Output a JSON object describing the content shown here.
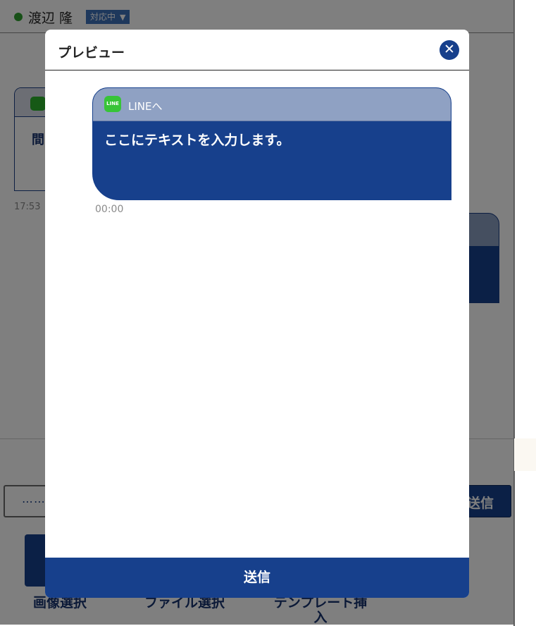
{
  "background": {
    "user": {
      "name": "渡辺 隆",
      "status_label": "対応中",
      "status_caret": "▼",
      "status_dot_color": "#2fa12f"
    },
    "card": {
      "text": "間っ",
      "channel_icon": "line-icon"
    },
    "message_time": "17:53",
    "keyboard_icon": "keyboard-icon",
    "send_label": "送信",
    "tools": {
      "image_label": "画像選択",
      "file_label": "ファイル選択",
      "template_label": "テンプレート挿入"
    }
  },
  "modal": {
    "title": "プレビュー",
    "close_icon": "close-icon",
    "bubble": {
      "channel_icon_text": "LINE",
      "channel_label": "LINEへ",
      "text": "ここにテキストを入力します。"
    },
    "time": "00:00",
    "send_label": "送信"
  },
  "colors": {
    "primary": "#17408c",
    "bubble_header": "#8fa1c3",
    "line_green": "#37c437",
    "overlay": "rgba(0,0,0,0.5)"
  }
}
